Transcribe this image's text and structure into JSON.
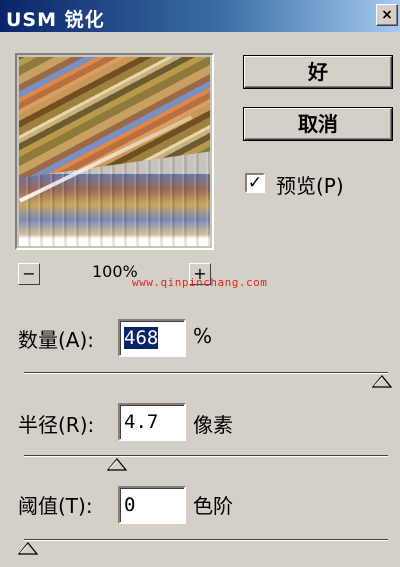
{
  "window": {
    "title": "USM 锐化",
    "close_symbol": "×"
  },
  "preview": {
    "zoom_level": "100%",
    "zoom_out_symbol": "−",
    "zoom_in_symbol": "+"
  },
  "watermark": "www.qinpinchang.com",
  "buttons": {
    "ok_label": "好",
    "cancel_label": "取消"
  },
  "preview_checkbox": {
    "checked": true,
    "mark": "✓",
    "label": "预览(P)"
  },
  "params": [
    {
      "label": "数量(A):",
      "value": "468",
      "unit": "%",
      "slider_fraction": 1.0
    },
    {
      "label": "半径(R):",
      "value": "4.7",
      "unit": "像素",
      "slider_fraction": 0.25
    },
    {
      "label": "阈值(T):",
      "value": "0",
      "unit": "色阶",
      "slider_fraction": 0.0
    }
  ],
  "colors": {
    "window_bg": "#d4d0c8",
    "title_bar": "#0a246a",
    "selection": "#0a246a",
    "watermark": "#e0261a"
  }
}
